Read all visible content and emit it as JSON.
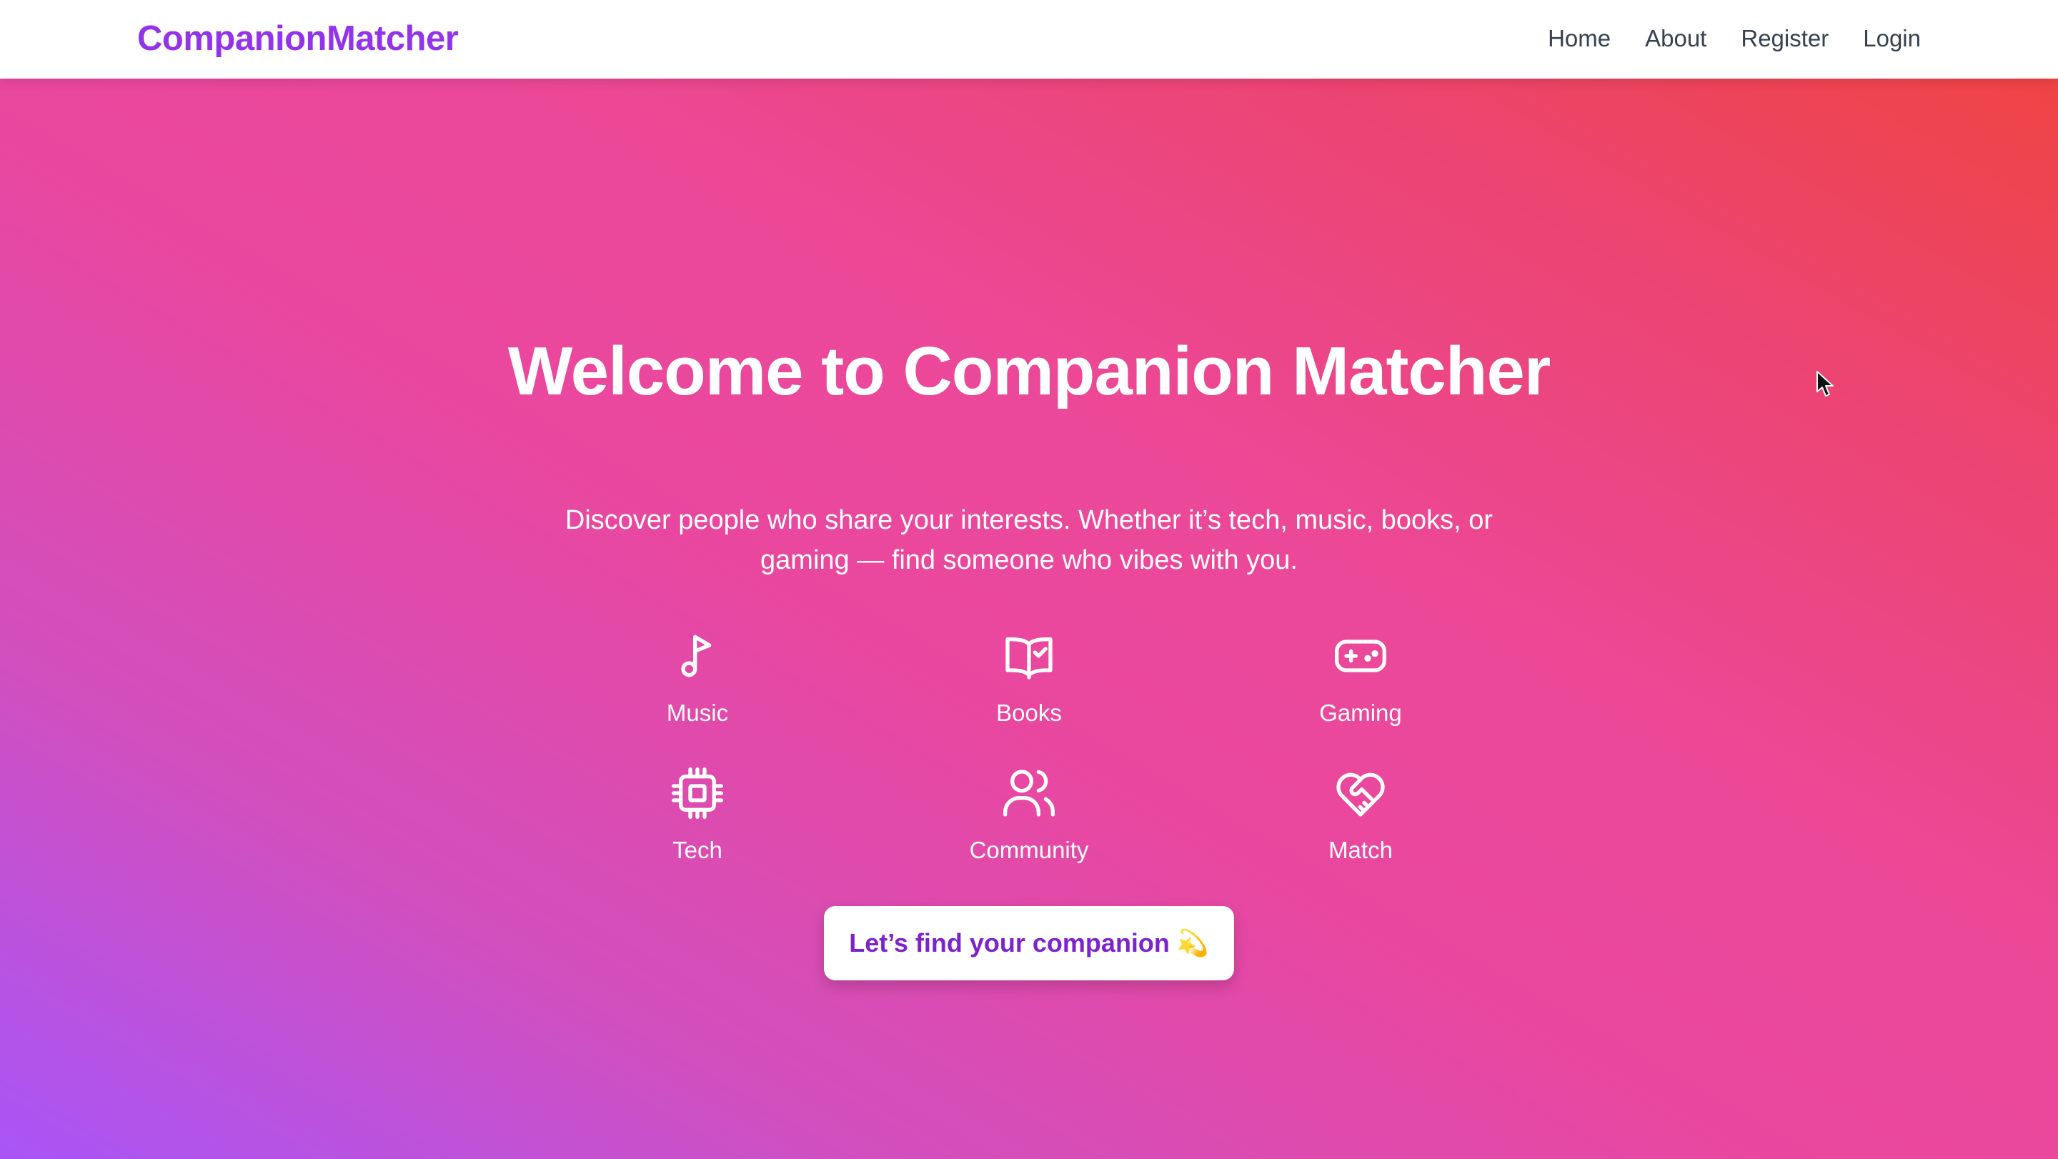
{
  "nav": {
    "brand": "CompanionMatcher",
    "links": [
      "Home",
      "About",
      "Register",
      "Login"
    ]
  },
  "hero": {
    "title": "Welcome to Companion Matcher",
    "subtitle": "Discover people who share your interests. Whether it’s tech, music, books, or gaming — find someone who vibes with you.",
    "interests": [
      {
        "label": "Music",
        "icon": "music-note-icon"
      },
      {
        "label": "Books",
        "icon": "book-check-icon"
      },
      {
        "label": "Gaming",
        "icon": "gamepad-icon"
      },
      {
        "label": "Tech",
        "icon": "cpu-chip-icon"
      },
      {
        "label": "Community",
        "icon": "users-icon"
      },
      {
        "label": "Match",
        "icon": "heart-handshake-icon"
      }
    ],
    "cta_label": "Let’s find your companion 💫"
  },
  "colors": {
    "brand": "#9333ea",
    "cta_text": "#7e22ce",
    "gradient_start": "#a855f7",
    "gradient_mid": "#ec4899",
    "gradient_end": "#ef4444"
  }
}
